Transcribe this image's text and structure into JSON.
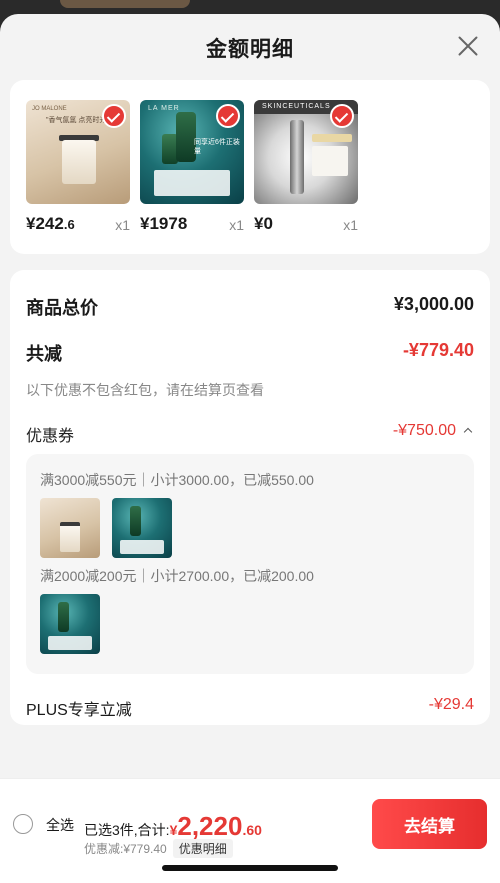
{
  "sheet": {
    "title": "金额明细"
  },
  "products": [
    {
      "price_main": "¥242",
      "price_decimal": ".6",
      "qty": "x1",
      "selected": true,
      "brand_hint": "JO MALONE",
      "slogan": "\"香气氤氲 点亮时光\""
    },
    {
      "price_main": "¥1978",
      "price_decimal": "",
      "qty": "x1",
      "selected": true,
      "brand_hint": "LA MER",
      "slogan": "同享近6件正装量"
    },
    {
      "price_main": "¥0",
      "price_decimal": "",
      "qty": "x1",
      "selected": true,
      "brand_hint": "SKINCEUTICALS",
      "slogan": ""
    }
  ],
  "details": {
    "goods_total_label": "商品总价",
    "goods_total_value": "¥3,000.00",
    "reduce_label": "共减",
    "reduce_value": "-¥779.40",
    "reduce_note": "以下优惠不包含红包，请在结算页查看",
    "coupon_label": "优惠券",
    "coupon_value": "-¥750.00",
    "coupon_rules": [
      "满3000减550元｜小计3000.00，已减550.00",
      "满2000减200元｜小计2700.00，已减200.00"
    ],
    "plus_label": "PLUS专享立减",
    "plus_value": "-¥29.4"
  },
  "bottom": {
    "select_all": "全选",
    "selected_prefix": "已选3件,合计:",
    "total_yen": "¥",
    "total_main": "2,220",
    "total_decimal": ".60",
    "discount_text": "优惠减:¥779.40",
    "detail_chip": "优惠明细",
    "checkout": "去结算"
  },
  "colors": {
    "accent": "#e53935",
    "sheet_bg": "#f3f3f3",
    "card_bg": "#ffffff"
  }
}
